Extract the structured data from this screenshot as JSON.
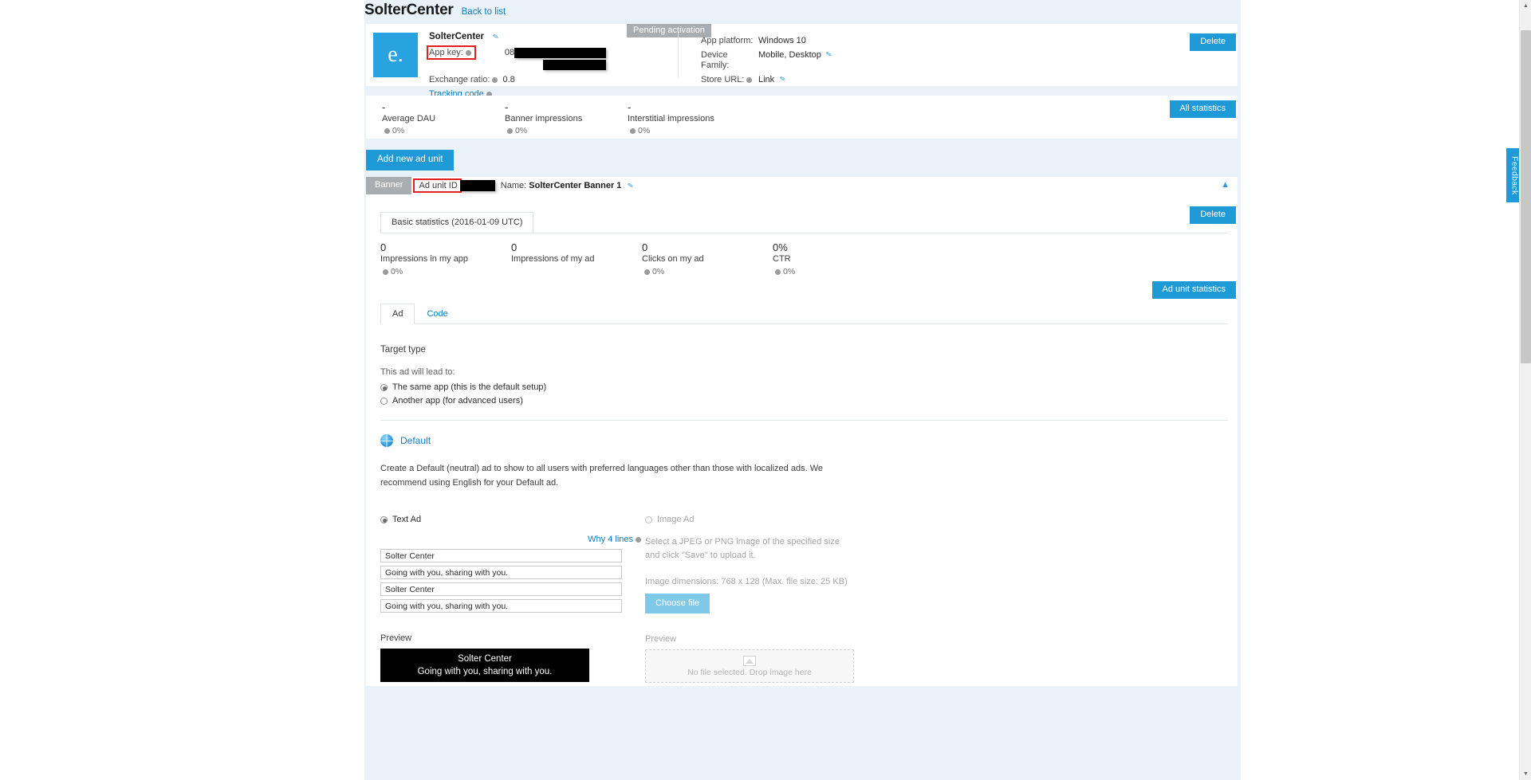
{
  "page": {
    "title": "SolterCenter",
    "back_link": "Back to list"
  },
  "app_card": {
    "logo_glyph": "e.",
    "name": "SolterCenter",
    "app_key_label": "App key:",
    "app_key_value_prefix": "08",
    "exchange_ratio_label": "Exchange ratio:",
    "exchange_ratio_value": "0.8",
    "tracking_code_label": "Tracking code",
    "status_badge": "Pending activation",
    "meta": [
      {
        "key": "App platform:",
        "value": "Windows 10"
      },
      {
        "key": "Device Family:",
        "value": "Mobile, Desktop"
      },
      {
        "key": "Store URL:",
        "value": "Link"
      }
    ],
    "delete_label": "Delete"
  },
  "app_stats": {
    "all_statistics_label": "All statistics",
    "items": [
      {
        "value": "-",
        "label": "Average DAU",
        "sub": "0%"
      },
      {
        "value": "-",
        "label": "Banner impressions",
        "sub": "0%"
      },
      {
        "value": "-",
        "label": "Interstitial impressions",
        "sub": "0%"
      }
    ]
  },
  "ad_units": {
    "add_button": "Add new ad unit",
    "unit": {
      "type": "Banner",
      "ad_unit_id_label": "Ad unit ID",
      "name_label": "Name:",
      "name_value": "SolterCenter Banner 1",
      "delete_label": "Delete",
      "basic_statistics_tab": "Basic statistics (2016-01-09 UTC)",
      "ad_unit_statistics_button": "Ad unit statistics",
      "stats": [
        {
          "value": "0",
          "label": "Impressions in my app",
          "sub": "0%"
        },
        {
          "value": "0",
          "label": "Impressions of my ad",
          "sub": ""
        },
        {
          "value": "0",
          "label": "Clicks on my ad",
          "sub": "0%"
        },
        {
          "value": "0%",
          "label": "CTR",
          "sub": "0%"
        }
      ],
      "tabs": [
        {
          "label": "Ad",
          "active": true
        },
        {
          "label": "Code",
          "active": false
        }
      ]
    }
  },
  "target_type": {
    "section_label": "Target type",
    "lead_text": "This ad will lead to:",
    "options": [
      {
        "label": "The same app (this is the default setup)",
        "selected": true
      },
      {
        "label": "Another app (for advanced users)",
        "selected": false
      }
    ]
  },
  "default_ad": {
    "title": "Default",
    "description": "Create a Default (neutral) ad to show to all users with preferred languages other than those with localized ads. We recommend using English for your Default ad.",
    "text_ad": {
      "radio_label": "Text Ad",
      "selected": true,
      "why_lines_label": "Why 4 lines",
      "lines": [
        "Solter Center",
        "Going with you, sharing with you.",
        "Solter Center",
        "Going with you, sharing with you."
      ],
      "preview_label": "Preview",
      "preview_line1": "Solter Center",
      "preview_line2": "Going with you, sharing with you."
    },
    "image_ad": {
      "radio_label": "Image Ad",
      "selected": false,
      "description": "Select a JPEG or PNG image of the specified size and click \"Save\" to upload it.",
      "dimensions": "Image dimensions: 768 x 128 (Max. file size: 25 KB)",
      "choose_file_label": "Choose file",
      "preview_label": "Preview",
      "dropzone_text": "No file selected. Drop image here"
    }
  },
  "feedback": {
    "label": "Feedback"
  },
  "colors": {
    "accent": "#1e9ad6",
    "link": "#0a7cc4",
    "highlight": "#e02020",
    "badge_gray": "#a8adb1",
    "page_bg": "#e8f2f8"
  }
}
